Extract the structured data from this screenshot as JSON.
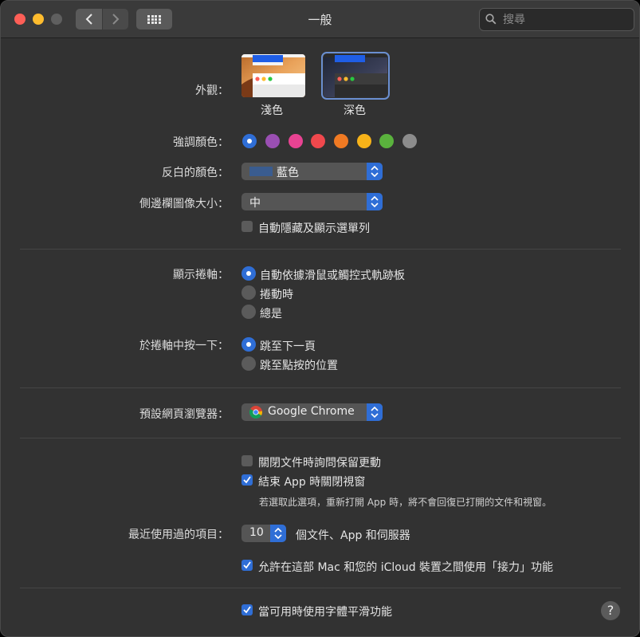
{
  "window": {
    "title": "一般",
    "search_placeholder": "搜尋"
  },
  "appearance": {
    "label": "外觀：",
    "options": [
      {
        "label": "淺色",
        "selected": false
      },
      {
        "label": "深色",
        "selected": true
      }
    ]
  },
  "accent": {
    "label": "強調顏色：",
    "colors": [
      "#2f6ed6",
      "#9a4fb3",
      "#e84392",
      "#f0484d",
      "#f07a23",
      "#f7b319",
      "#5ab23d",
      "#8c8c8c"
    ],
    "selected_index": 0
  },
  "highlight": {
    "label": "反白的顏色：",
    "value": "藍色",
    "swatch_color": "#3a5c8f"
  },
  "sidebar_icon_size": {
    "label": "側邊欄圖像大小：",
    "value": "中"
  },
  "auto_hide_menu": {
    "label": "自動隱藏及顯示選單列",
    "checked": false
  },
  "show_scrollbars": {
    "label": "顯示捲軸：",
    "options": [
      {
        "label": "自動依據滑鼠或觸控式軌跡板",
        "selected": true
      },
      {
        "label": "捲動時",
        "selected": false
      },
      {
        "label": "總是",
        "selected": false
      }
    ]
  },
  "click_scrollbar": {
    "label": "於捲軸中按一下：",
    "options": [
      {
        "label": "跳至下一頁",
        "selected": true
      },
      {
        "label": "跳至點按的位置",
        "selected": false
      }
    ]
  },
  "default_browser": {
    "label": "預設網頁瀏覽器：",
    "value": "Google Chrome"
  },
  "ask_keep_changes": {
    "label": "關閉文件時詢問保留更動",
    "checked": false
  },
  "close_windows": {
    "label": "結束 App 時關閉視窗",
    "checked": true,
    "note": "若選取此選項，重新打開 App 時，將不會回復已打開的文件和視窗。"
  },
  "recent_items": {
    "label": "最近使用過的項目：",
    "value": "10",
    "suffix": "個文件、App 和伺服器"
  },
  "handoff": {
    "label": "允許在這部 Mac 和您的 iCloud 裝置之間使用「接力」功能",
    "checked": true
  },
  "font_smoothing": {
    "label": "當可用時使用字體平滑功能",
    "checked": true
  },
  "help_label": "?"
}
